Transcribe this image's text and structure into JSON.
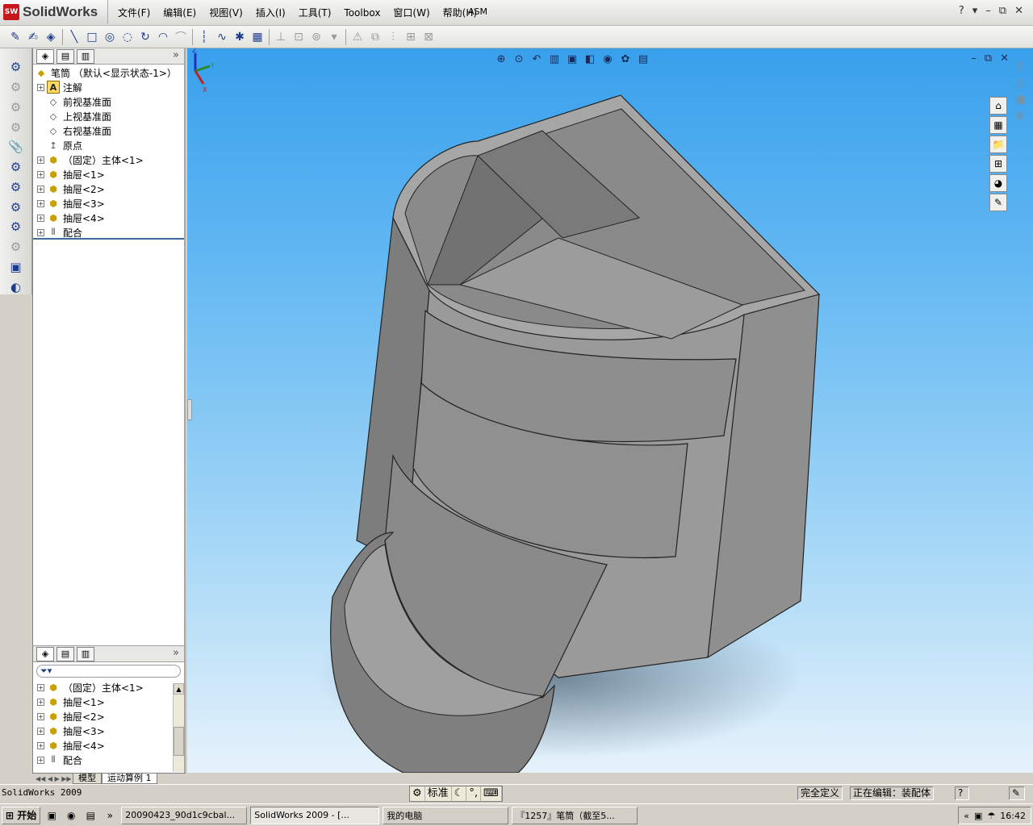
{
  "app": {
    "logo_text": "SolidWorks",
    "logo_badge": "SW",
    "title_fragment": "ASM"
  },
  "menu": [
    "文件(F)",
    "编辑(E)",
    "视图(V)",
    "插入(I)",
    "工具(T)",
    "Toolbox",
    "窗口(W)",
    "帮助(H)"
  ],
  "window_controls": {
    "help": "?",
    "dropdown": "▾",
    "minimize": "–",
    "restore": "⧉",
    "close": "✕"
  },
  "feature_manager": {
    "tabs_expand": "»",
    "tree": [
      {
        "label": "笔筒  （默认<显示状态-1>）",
        "icon": "assembly-icon",
        "level": 0
      },
      {
        "label": "注解",
        "icon": "annotation-icon",
        "glyph": "A",
        "level": 1,
        "expandable": true
      },
      {
        "label": "前视基准面",
        "icon": "plane-icon",
        "level": 1
      },
      {
        "label": "上视基准面",
        "icon": "plane-icon",
        "level": 1
      },
      {
        "label": "右视基准面",
        "icon": "plane-icon",
        "level": 1
      },
      {
        "label": "原点",
        "icon": "origin-icon",
        "level": 1
      },
      {
        "label": "（固定）主体<1>",
        "icon": "part-icon",
        "level": 1,
        "expandable": true
      },
      {
        "label": "抽屉<1>",
        "icon": "part-icon",
        "level": 1,
        "expandable": true
      },
      {
        "label": "抽屉<2>",
        "icon": "part-icon",
        "level": 1,
        "expandable": true
      },
      {
        "label": "抽屉<3>",
        "icon": "part-icon",
        "level": 1,
        "expandable": true
      },
      {
        "label": "抽屉<4>",
        "icon": "part-icon",
        "level": 1,
        "expandable": true
      },
      {
        "label": "配合",
        "icon": "mates-icon",
        "level": 1,
        "expandable": true
      }
    ]
  },
  "motion_panel": {
    "filter_icon": "filter-icon",
    "tree": [
      {
        "label": "（固定）主体<1>"
      },
      {
        "label": "抽屉<1>"
      },
      {
        "label": "抽屉<2>"
      },
      {
        "label": "抽屉<3>"
      },
      {
        "label": "抽屉<4>"
      },
      {
        "label": "配合"
      }
    ],
    "tabs": [
      "模型",
      "运动算例 1"
    ]
  },
  "triad": {
    "x": "X",
    "y": "Y",
    "z": "Z"
  },
  "status": {
    "app_version": "SolidWorks 2009",
    "ime_mode": "标准",
    "definition": "完全定义",
    "editing": "正在编辑：装配体",
    "help": "?"
  },
  "taskbar": {
    "start": "开始",
    "tasks": [
      "20090423_90d1c9cbal...",
      "SolidWorks 2009 - [...",
      "我的电脑",
      "『1257』笔筒（截至5..."
    ],
    "time": "16:42"
  },
  "colors": {
    "viewport_top": "#39a0ec",
    "viewport_bottom": "#e6f2fb",
    "model_face": "#8c8c8c"
  }
}
